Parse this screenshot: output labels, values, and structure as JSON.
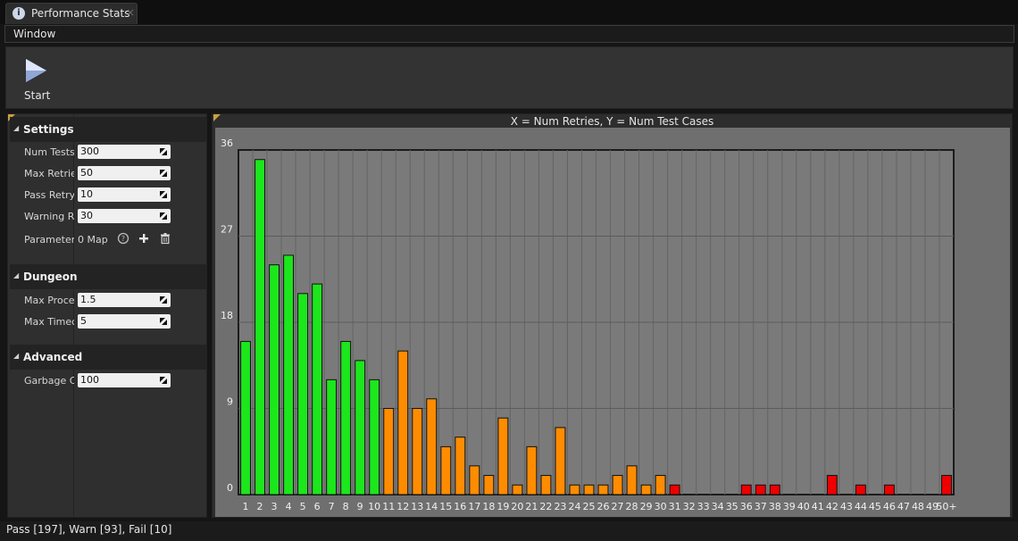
{
  "tab": {
    "icon": "performance-stats-icon",
    "title": "Performance Stats",
    "close": "×"
  },
  "menu": {
    "items": [
      "Window"
    ]
  },
  "toolbar": {
    "start_label": "Start",
    "start_icon": "play-icon"
  },
  "settings": {
    "sections": [
      {
        "title": "Settings",
        "rows": [
          {
            "label": "Num Tests",
            "value": "300"
          },
          {
            "label": "Max Retries",
            "value": "50"
          },
          {
            "label": "Pass Retry",
            "value": "10"
          },
          {
            "label": "Warning Re",
            "value": "30"
          },
          {
            "label": "Parameter",
            "map_text": "0 Map",
            "icons": [
              "help-icon",
              "add-icon",
              "delete-icon"
            ]
          }
        ]
      },
      {
        "title": "Dungeon",
        "rows": [
          {
            "label": "Max Proce",
            "value": "1.5"
          },
          {
            "label": "Max Timec",
            "value": "5"
          }
        ]
      },
      {
        "title": "Advanced",
        "rows": [
          {
            "label": "Garbage Co",
            "value": "100"
          }
        ]
      }
    ]
  },
  "chart_title": "X = Num Retries, Y = Num Test Cases",
  "chart_data": {
    "type": "bar",
    "title": "X = Num Retries, Y = Num Test Cases",
    "xlabel": "",
    "ylabel": "",
    "ylim": [
      0,
      36
    ],
    "yticks": [
      "0",
      "9",
      "18",
      "27",
      "36"
    ],
    "grid": true,
    "categories": [
      "1",
      "2",
      "3",
      "4",
      "5",
      "6",
      "7",
      "8",
      "9",
      "10",
      "11",
      "12",
      "13",
      "14",
      "15",
      "16",
      "17",
      "18",
      "19",
      "20",
      "21",
      "22",
      "23",
      "24",
      "25",
      "26",
      "27",
      "28",
      "29",
      "30",
      "31",
      "32",
      "33",
      "34",
      "35",
      "36",
      "37",
      "38",
      "39",
      "40",
      "41",
      "42",
      "43",
      "44",
      "45",
      "46",
      "47",
      "48",
      "49",
      "50+"
    ],
    "values": [
      16,
      35,
      24,
      25,
      21,
      22,
      12,
      16,
      14,
      12,
      9,
      15,
      9,
      10,
      5,
      6,
      3,
      2,
      8,
      1,
      5,
      2,
      7,
      1,
      1,
      1,
      2,
      3,
      1,
      2,
      1,
      0,
      0,
      0,
      0,
      1,
      1,
      1,
      0,
      0,
      0,
      2,
      0,
      1,
      0,
      1,
      0,
      0,
      0,
      2
    ],
    "colors": {
      "pass": "#1ce61c",
      "warn": "#ff8c00",
      "fail": "#ee0000"
    },
    "pass_max_category": "10",
    "warn_max_category": "30"
  },
  "status": "Pass [197], Warn [93], Fail [10]"
}
